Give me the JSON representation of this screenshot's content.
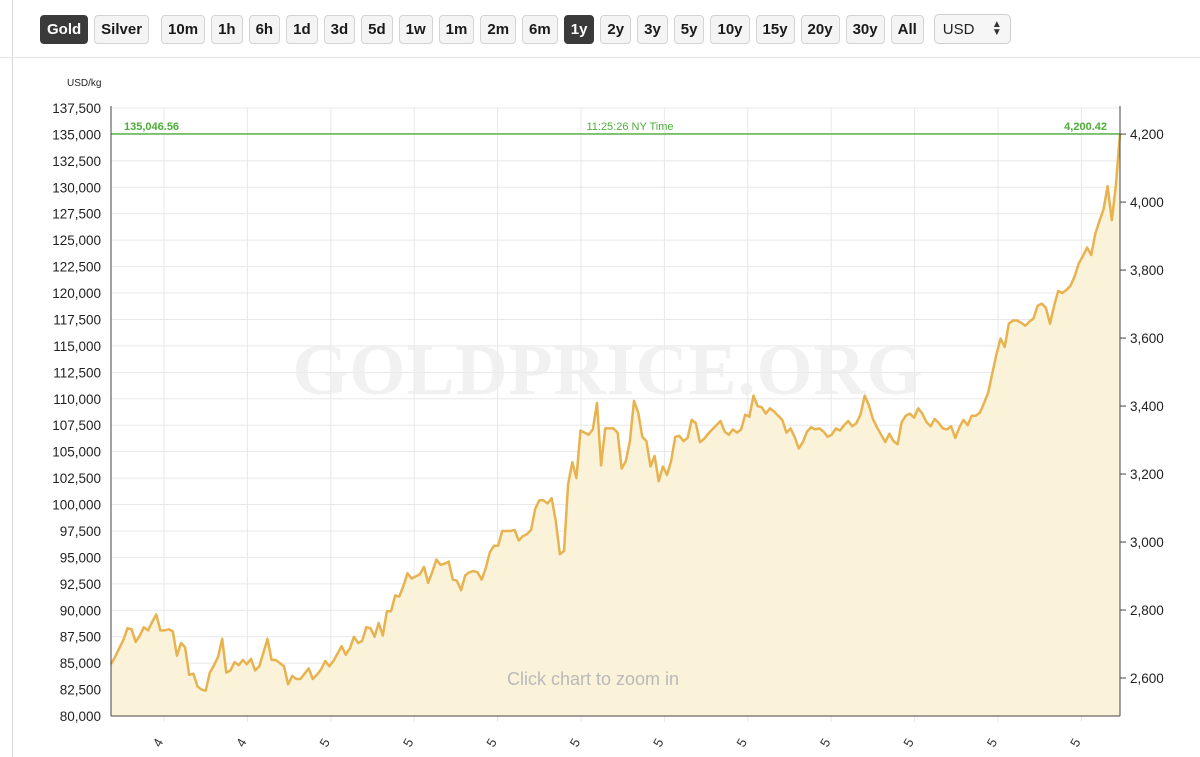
{
  "toolbar": {
    "metals": [
      {
        "label": "Gold",
        "active": true
      },
      {
        "label": "Silver",
        "active": false
      }
    ],
    "ranges": [
      {
        "label": "10m",
        "active": false
      },
      {
        "label": "1h",
        "active": false
      },
      {
        "label": "6h",
        "active": false
      },
      {
        "label": "1d",
        "active": false
      },
      {
        "label": "3d",
        "active": false
      },
      {
        "label": "5d",
        "active": false
      },
      {
        "label": "1w",
        "active": false
      },
      {
        "label": "1m",
        "active": false
      },
      {
        "label": "2m",
        "active": false
      },
      {
        "label": "6m",
        "active": false
      },
      {
        "label": "1y",
        "active": true
      },
      {
        "label": "2y",
        "active": false
      },
      {
        "label": "3y",
        "active": false
      },
      {
        "label": "5y",
        "active": false
      },
      {
        "label": "10y",
        "active": false
      },
      {
        "label": "15y",
        "active": false
      },
      {
        "label": "20y",
        "active": false
      },
      {
        "label": "30y",
        "active": false
      },
      {
        "label": "All",
        "active": false
      }
    ],
    "currency": "USD"
  },
  "chart_data": {
    "type": "area",
    "ylabel_left": "USD/kg",
    "left_axis": {
      "ticks": [
        "137,500",
        "135,000",
        "132,500",
        "130,000",
        "127,500",
        "125,000",
        "122,500",
        "120,000",
        "117,500",
        "115,000",
        "112,500",
        "110,000",
        "107,500",
        "105,000",
        "102,500",
        "100,000",
        "97,500",
        "95,000",
        "92,500",
        "90,000",
        "87,500",
        "85,000",
        "82,500",
        "80,000"
      ],
      "range": [
        80000,
        137500
      ]
    },
    "right_axis": {
      "ticks": [
        "4,200",
        "4,000",
        "3,800",
        "3,600",
        "3,400",
        "3,200",
        "3,000",
        "2,800",
        "2,600"
      ]
    },
    "x_tick_labels": [
      "4",
      "4",
      "5",
      "5",
      "5",
      "5",
      "5",
      "5",
      "5",
      "5",
      "5",
      "5"
    ],
    "current": {
      "left_value": "135,046.56",
      "time": "11:25:26 NY Time",
      "right_value": "4,200.42"
    },
    "watermark": "GOLDPRICE.ORG",
    "hint": "Click chart to zoom in",
    "grid": true,
    "colors": {
      "line": "#e8b34f",
      "fill": "#fbf2da",
      "current_line": "#4cae38",
      "grid": "#e8e8e8"
    },
    "series": [
      {
        "values": [
          84900,
          85600,
          86400,
          87200,
          88300,
          88200,
          87000,
          87600,
          88400,
          88100,
          88900,
          89600,
          88100,
          88100,
          88200,
          88000,
          85700,
          86900,
          86500,
          83900,
          84000,
          82800,
          82500,
          82400,
          84100,
          84800,
          85600,
          87300,
          84100,
          84300,
          85100,
          84800,
          85300,
          84900,
          85400,
          84300,
          84700,
          86000,
          87300,
          85300,
          85300,
          85000,
          84700,
          83000,
          83800,
          83500,
          83500,
          84000,
          84500,
          83500,
          83900,
          84400,
          85200,
          84700,
          85200,
          85900,
          86600,
          85800,
          86400,
          87500,
          86900,
          87100,
          88400,
          88300,
          87500,
          88800,
          87600,
          89900,
          89900,
          91400,
          91300,
          92300,
          93500,
          93000,
          93200,
          93400,
          94100,
          92600,
          93600,
          94800,
          94300,
          94400,
          94600,
          92900,
          92800,
          91900,
          93300,
          93600,
          93700,
          93600,
          92900,
          94000,
          95500,
          96100,
          96100,
          97500,
          97500,
          97500,
          97600,
          96600,
          97000,
          97200,
          97600,
          99600,
          100400,
          100400,
          100100,
          100600,
          98400,
          95300,
          95600,
          101900,
          104000,
          102500,
          107000,
          106800,
          106600,
          107100,
          109600,
          103700,
          107200,
          107200,
          107200,
          106800,
          103400,
          104100,
          106000,
          109800,
          108700,
          106400,
          106000,
          103600,
          104600,
          102200,
          103600,
          102800,
          104100,
          106400,
          106500,
          106000,
          106300,
          108000,
          107700,
          105900,
          106200,
          106700,
          107100,
          107500,
          107900,
          106900,
          106600,
          107100,
          106800,
          107100,
          108500,
          108300,
          110300,
          109300,
          109200,
          108600,
          109100,
          108800,
          108400,
          108000,
          106800,
          107200,
          106400,
          105300,
          105900,
          106900,
          107300,
          107100,
          107200,
          106900,
          106400,
          106600,
          107200,
          107000,
          107500,
          107900,
          107400,
          107700,
          108500,
          110300,
          109400,
          108100,
          107300,
          106600,
          105900,
          106700,
          106000,
          105700,
          107800,
          108400,
          108600,
          108200,
          109100,
          108600,
          107800,
          107400,
          108100,
          107700,
          107200,
          107100,
          107400,
          106300,
          107300,
          108000,
          107500,
          108400,
          108400,
          108700,
          109600,
          110600,
          112400,
          114200,
          115700,
          114900,
          117100,
          117400,
          117400,
          117200,
          116900,
          117300,
          117600,
          118800,
          119000,
          118600,
          117100,
          118800,
          120200,
          120000,
          120300,
          120700,
          121600,
          122800,
          123500,
          124300,
          123600,
          125600,
          126800,
          127900,
          130100,
          126900,
          130200,
          135047
        ]
      }
    ]
  }
}
